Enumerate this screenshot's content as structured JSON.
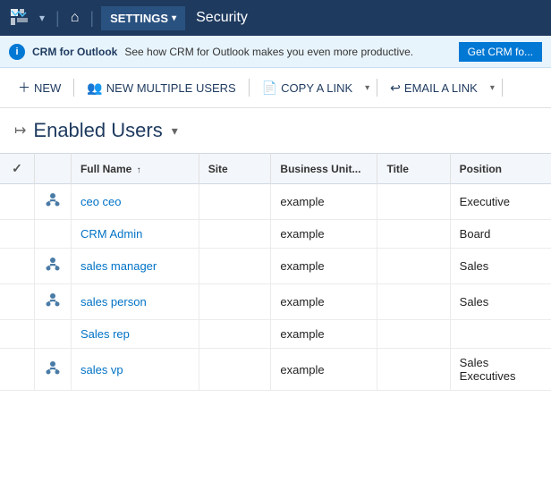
{
  "nav": {
    "logo_label": "App Logo",
    "dropdown_arrow": "▾",
    "home_icon": "⌂",
    "settings_label": "SETTINGS",
    "settings_caret": "▾",
    "separator": "|",
    "security_label": "Security"
  },
  "banner": {
    "icon_text": "i",
    "title": "CRM for Outlook",
    "message": "See how CRM for Outlook makes you even more productive.",
    "button_label": "Get CRM fo..."
  },
  "toolbar": {
    "new_label": "NEW",
    "new_multiple_label": "NEW MULTIPLE USERS",
    "copy_link_label": "COPY A LINK",
    "email_link_label": "EMAIL A LINK"
  },
  "page": {
    "header_icon": "→",
    "title": "Enabled Users",
    "title_dropdown": "▾"
  },
  "table": {
    "columns": [
      {
        "id": "check",
        "label": "✓",
        "sort": ""
      },
      {
        "id": "icon",
        "label": "",
        "sort": ""
      },
      {
        "id": "fullname",
        "label": "Full Name",
        "sort": "↑"
      },
      {
        "id": "site",
        "label": "Site",
        "sort": ""
      },
      {
        "id": "businessunit",
        "label": "Business Unit...",
        "sort": ""
      },
      {
        "id": "title",
        "label": "Title",
        "sort": ""
      },
      {
        "id": "position",
        "label": "Position",
        "sort": ""
      }
    ],
    "rows": [
      {
        "check": "",
        "has_icon": true,
        "fullname": "ceo ceo",
        "site": "",
        "businessunit": "example",
        "title": "",
        "position": "Executive"
      },
      {
        "check": "",
        "has_icon": false,
        "fullname": "CRM Admin",
        "site": "",
        "businessunit": "example",
        "title": "",
        "position": "Board"
      },
      {
        "check": "",
        "has_icon": true,
        "fullname": "sales manager",
        "site": "",
        "businessunit": "example",
        "title": "",
        "position": "Sales"
      },
      {
        "check": "",
        "has_icon": true,
        "fullname": "sales person",
        "site": "",
        "businessunit": "example",
        "title": "",
        "position": "Sales"
      },
      {
        "check": "",
        "has_icon": false,
        "fullname": "Sales rep",
        "site": "",
        "businessunit": "example",
        "title": "",
        "position": ""
      },
      {
        "check": "",
        "has_icon": true,
        "fullname": "sales vp",
        "site": "",
        "businessunit": "example",
        "title": "",
        "position": "Sales Executives"
      }
    ]
  }
}
